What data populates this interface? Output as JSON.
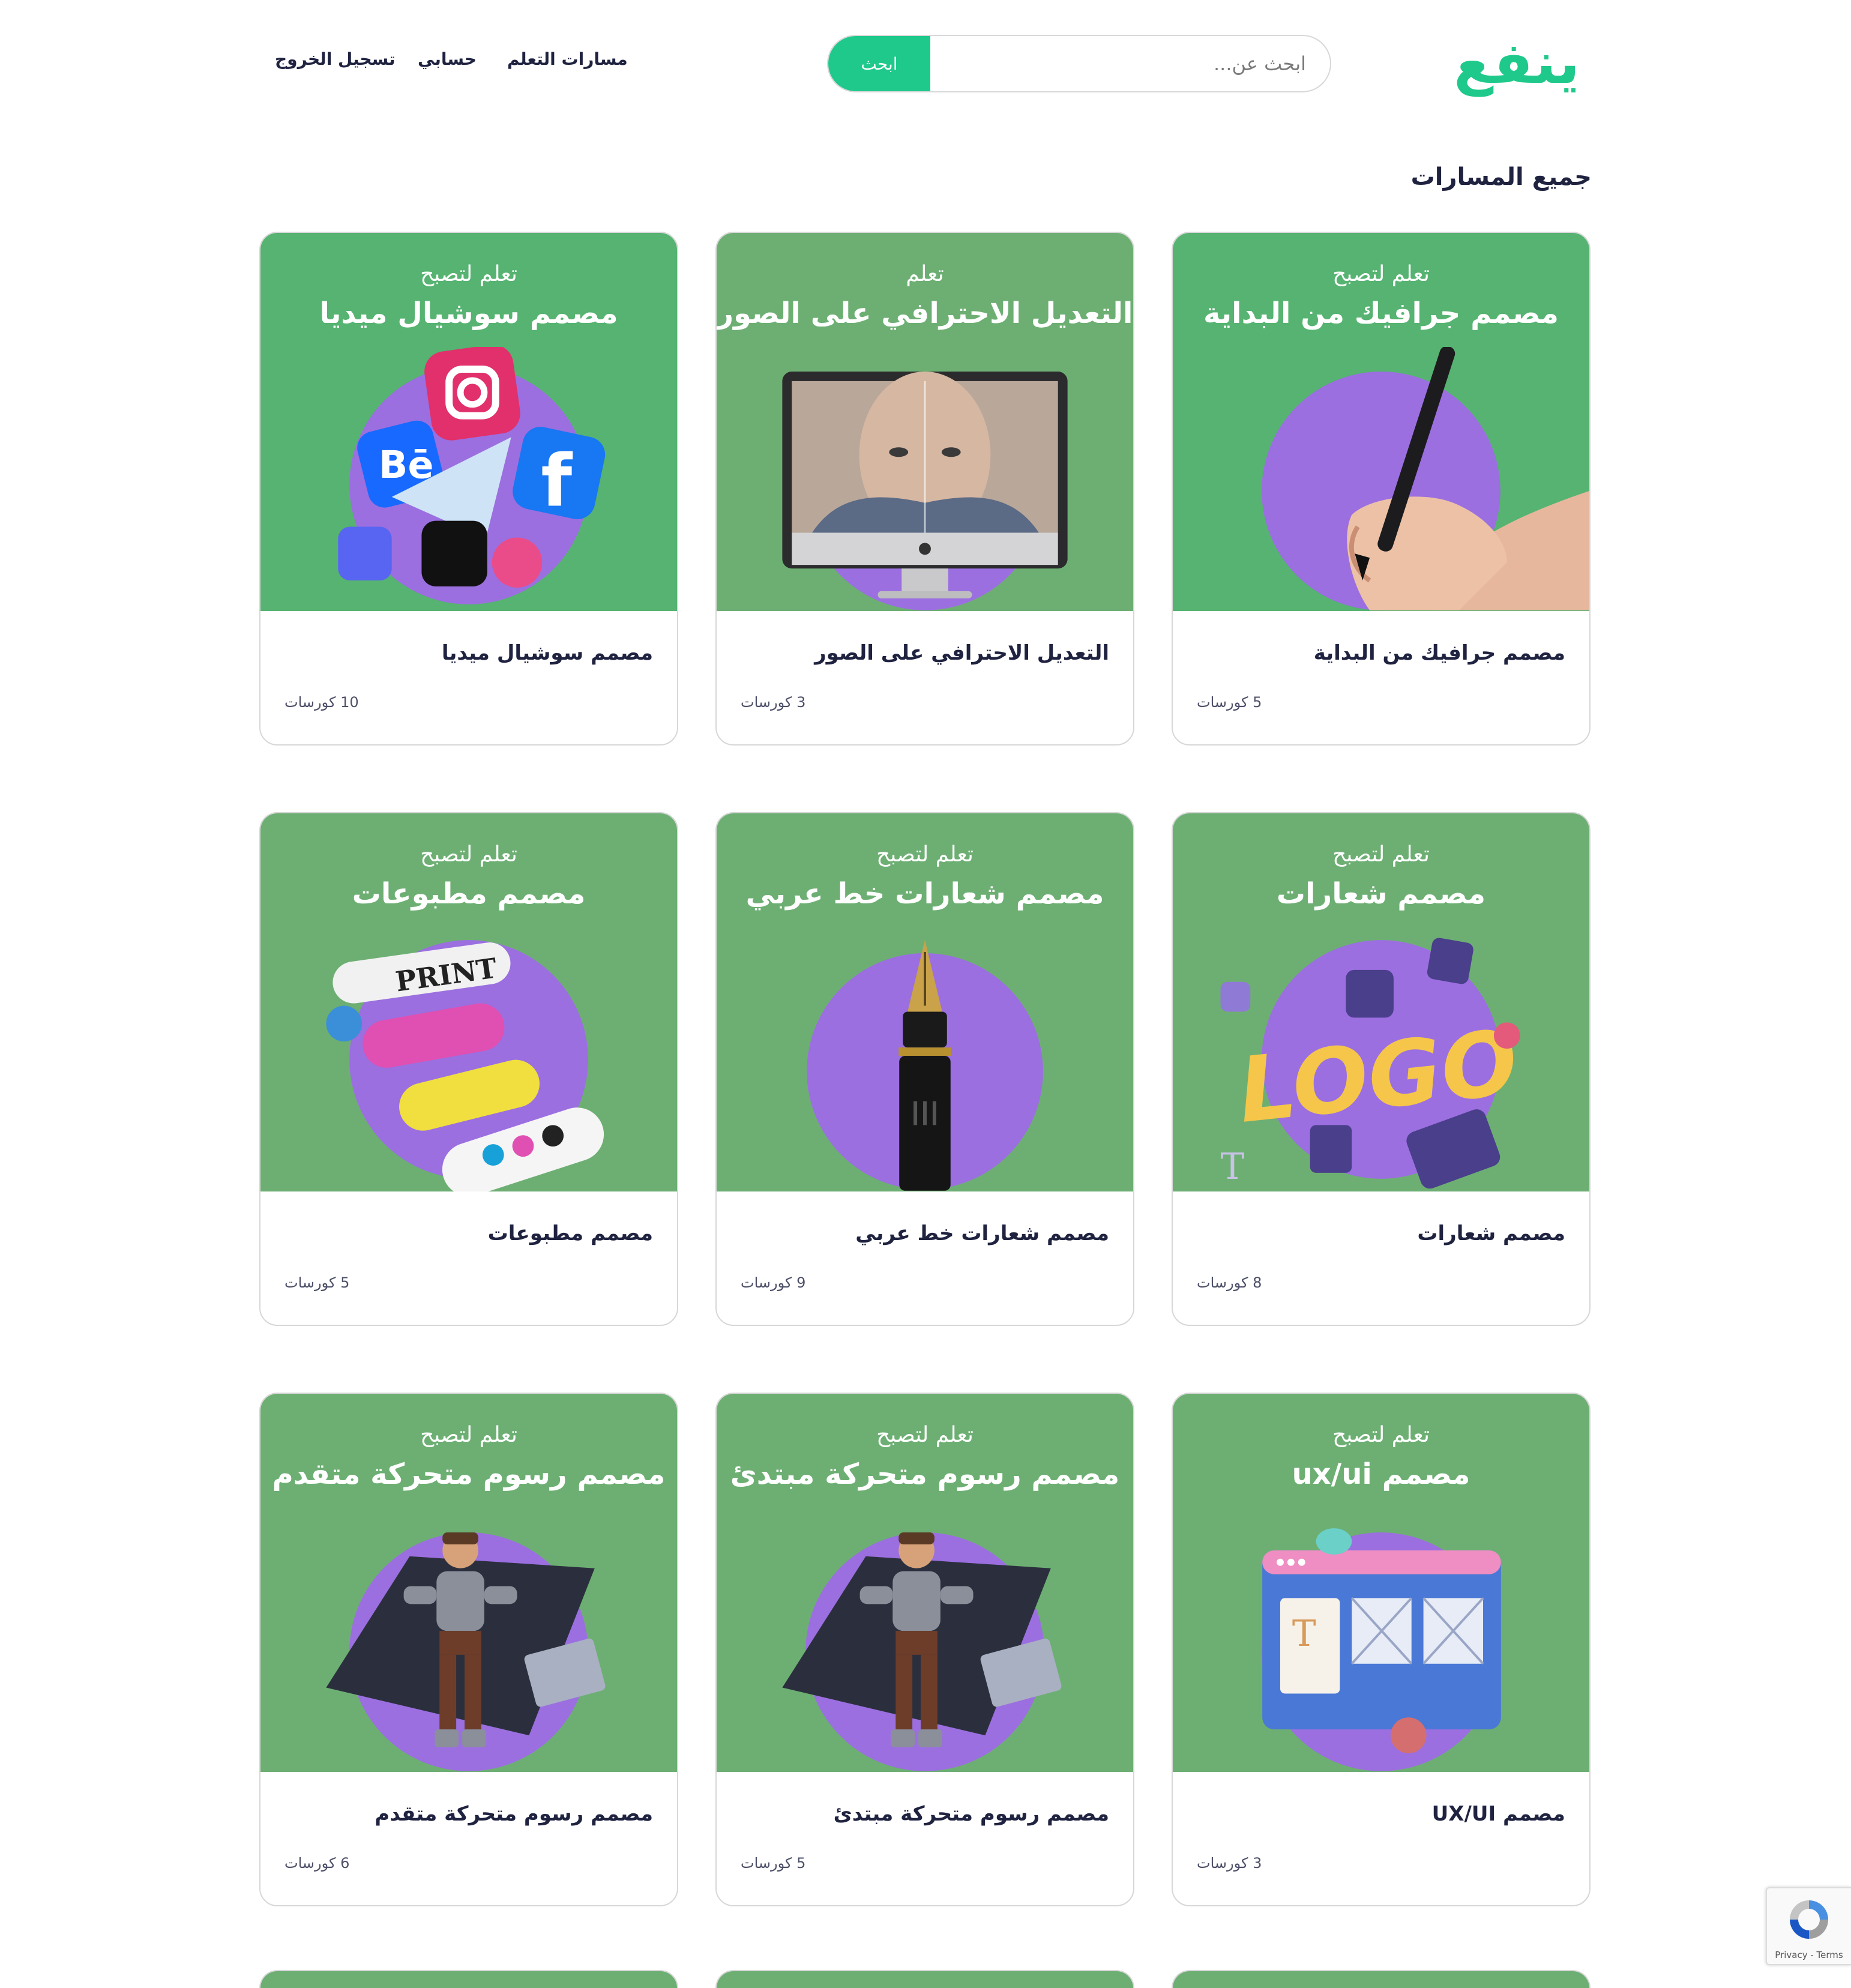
{
  "header": {
    "logo_text": "ينفع",
    "search_placeholder": "ابحث عن...",
    "search_button": "ابحث",
    "nav": {
      "paths": "مسارات التعلم",
      "account": "حسابي",
      "logout": "تسجيل الخروج"
    }
  },
  "section_title": "جميع المسارات",
  "colors": {
    "brand": "#1fc98b",
    "card_bg": "#6daf73",
    "purple": "#9b6fe0"
  },
  "cards": [
    {
      "sub": "تعلم لتصبح",
      "title": "مصمم جرافيك من البداية",
      "name": "مصمم جرافيك من البداية",
      "count": "5 كورسات",
      "icon": "pen-hand-icon"
    },
    {
      "sub": "تعلم",
      "title": "التعديل الاحترافي على الصور",
      "name": "التعديل الاحترافي على الصور",
      "count": "3 كورسات",
      "icon": "monitor-face-icon"
    },
    {
      "sub": "تعلم لتصبح",
      "title": "مصمم سوشيال ميديا",
      "name": "مصمم سوشيال ميديا",
      "count": "10 كورسات",
      "icon": "social-media-icon"
    },
    {
      "sub": "تعلم لتصبح",
      "title": "مصمم شعارات",
      "name": "مصمم شعارات",
      "count": "8 كورسات",
      "icon": "logo-icon"
    },
    {
      "sub": "تعلم لتصبح",
      "title": "مصمم شعارات خط عربي",
      "name": "مصمم شعارات خط عربي",
      "count": "9 كورسات",
      "icon": "fountain-pen-icon"
    },
    {
      "sub": "تعلم لتصبح",
      "title": "مصمم مطبوعات",
      "name": "مصمم مطبوعات",
      "count": "5 كورسات",
      "icon": "print-rollers-icon"
    },
    {
      "sub": "تعلم لتصبح",
      "title": "مصمم ux/ui",
      "name": "مصمم UX/UI",
      "count": "3 كورسات",
      "icon": "ui-window-icon"
    },
    {
      "sub": "تعلم لتصبح",
      "title": "مصمم رسوم متحركة مبتدئ",
      "name": "مصمم رسوم متحركة مبتدئ",
      "count": "5 كورسات",
      "icon": "animation-character-icon"
    },
    {
      "sub": "تعلم لتصبح",
      "title": "مصمم رسوم متحركة متقدم",
      "name": "مصمم رسوم متحركة متقدم",
      "count": "6 كورسات",
      "icon": "animation-character-icon"
    }
  ],
  "recaptcha_text": "Privacy - Terms"
}
